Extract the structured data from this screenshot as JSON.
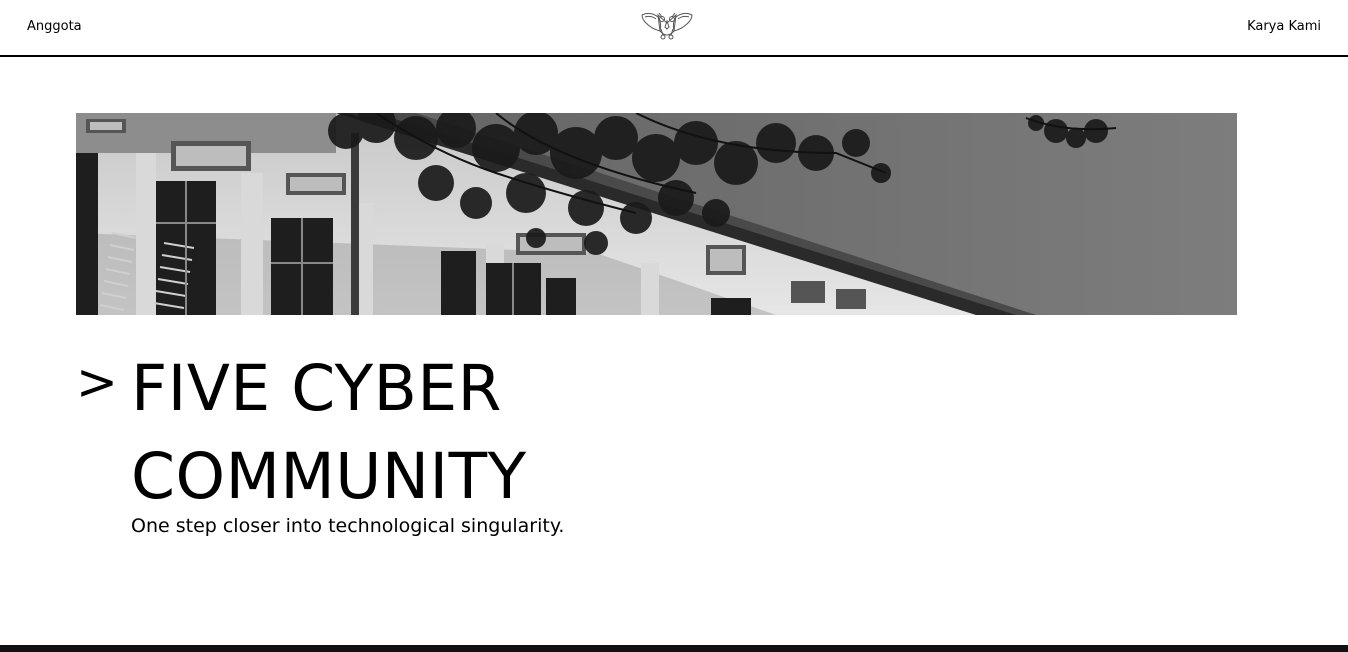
{
  "nav": {
    "left_link": "Anggota",
    "right_link": "Karya Kami",
    "logo_icon": "owl-logo-icon"
  },
  "hero": {
    "image_description_icon": "building-photo",
    "prompt_symbol": ">",
    "title": "FIVE CYBER COMMUNITY",
    "tagline": "One step closer into technological singularity."
  },
  "colors": {
    "background": "#ffffff",
    "text": "#000000",
    "rule": "#000000",
    "footer": "#111111"
  }
}
